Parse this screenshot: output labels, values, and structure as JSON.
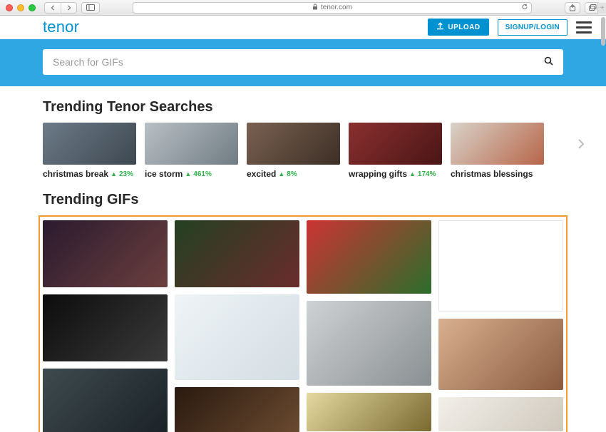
{
  "browser": {
    "url_host": "tenor.com",
    "lock_icon": "lock-icon",
    "reload_icon": "reload-icon"
  },
  "header": {
    "brand": "tenor",
    "upload_label": "UPLOAD",
    "auth_label": "SIGNUP/LOGIN"
  },
  "search": {
    "placeholder": "Search for GIFs"
  },
  "trending_searches": {
    "title": "Trending Tenor Searches",
    "items": [
      {
        "label": "christmas break",
        "pct": "23%",
        "thumb_bg": "linear-gradient(135deg,#6d7b88,#3d4750)"
      },
      {
        "label": "ice storm",
        "pct": "461%",
        "thumb_bg": "linear-gradient(135deg,#b9c0c6,#707b83)"
      },
      {
        "label": "excited",
        "pct": "8%",
        "thumb_bg": "linear-gradient(135deg,#7a6152,#3c2f25)"
      },
      {
        "label": "wrapping gifts",
        "pct": "174%",
        "thumb_bg": "linear-gradient(135deg,#8a2f2f,#4a1616)"
      },
      {
        "label": "christmas blessings",
        "pct": "",
        "thumb_bg": "linear-gradient(135deg,#d9d3c9,#b7654a)"
      }
    ]
  },
  "trending_gifs": {
    "title": "Trending GIFs",
    "columns": [
      [
        {
          "h": 94,
          "bg": "linear-gradient(135deg,#2a1b2e,#6b3f3f)"
        },
        {
          "h": 94,
          "bg": "linear-gradient(135deg,#0c0c0c,#3a3a3a)"
        },
        {
          "h": 92,
          "bg": "linear-gradient(135deg,#3e4a4f,#1a2226)"
        }
      ],
      [
        {
          "h": 94,
          "bg": "linear-gradient(135deg,#234021,#6a2c2c)"
        },
        {
          "h": 120,
          "bg": "linear-gradient(135deg,#eef4f7,#d4dde3)"
        },
        {
          "h": 64,
          "bg": "linear-gradient(135deg,#2a1a10,#6a4a30)"
        }
      ],
      [
        {
          "h": 103,
          "bg": "linear-gradient(135deg,#c33,#2c6e2c)"
        },
        {
          "h": 119,
          "bg": "linear-gradient(135deg,#cfd2d4,#8a8f92)"
        },
        {
          "h": 54,
          "bg": "linear-gradient(135deg,#e4d9a1,#7a6a30)"
        }
      ],
      [
        {
          "h": 128,
          "bg": "#ffffff",
          "border": true
        },
        {
          "h": 100,
          "bg": "linear-gradient(135deg,#d8b08f,#8a5a3f)"
        },
        {
          "h": 48,
          "bg": "linear-gradient(135deg,#f2efe9,#cfc9bd)"
        }
      ]
    ]
  }
}
